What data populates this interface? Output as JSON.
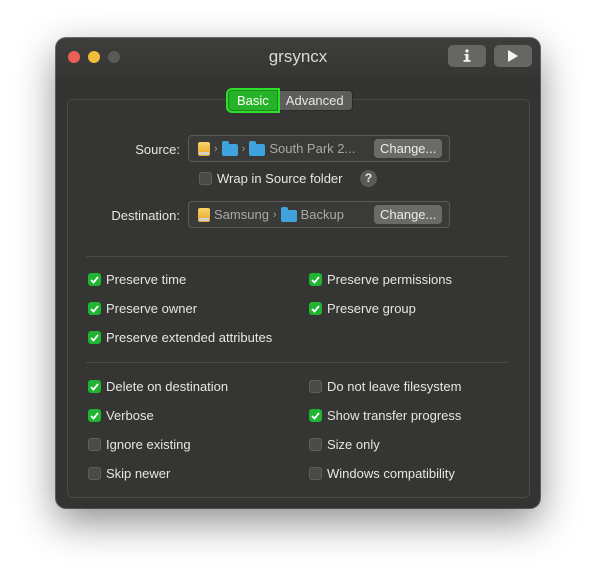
{
  "window": {
    "title": "grsyncx"
  },
  "toolbar": {
    "info_icon": "info-icon",
    "play_icon": "play-icon"
  },
  "tabs": [
    {
      "label": "Basic",
      "selected": true
    },
    {
      "label": "Advanced",
      "selected": false
    }
  ],
  "source": {
    "label": "Source:",
    "path": [
      "",
      "",
      "South Park 2..."
    ],
    "change_label": "Change..."
  },
  "wrap": {
    "label": "Wrap in Source folder",
    "checked": false,
    "help": "?"
  },
  "destination": {
    "label": "Destination:",
    "path": [
      "Samsung",
      "Backup"
    ],
    "change_label": "Change..."
  },
  "group1": [
    {
      "label": "Preserve time",
      "checked": true
    },
    {
      "label": "Preserve permissions",
      "checked": true
    },
    {
      "label": "Preserve owner",
      "checked": true
    },
    {
      "label": "Preserve group",
      "checked": true
    },
    {
      "label": "Preserve extended attributes",
      "checked": true
    }
  ],
  "group2": [
    {
      "label": "Delete on destination",
      "checked": true
    },
    {
      "label": "Do not leave filesystem",
      "checked": false
    },
    {
      "label": "Verbose",
      "checked": true
    },
    {
      "label": "Show transfer progress",
      "checked": true
    },
    {
      "label": "Ignore existing",
      "checked": false
    },
    {
      "label": "Size only",
      "checked": false
    },
    {
      "label": "Skip newer",
      "checked": false
    },
    {
      "label": "Windows compatibility",
      "checked": false
    }
  ],
  "colors": {
    "accent_green": "#1fb431",
    "tab_selected": "#27b327"
  }
}
